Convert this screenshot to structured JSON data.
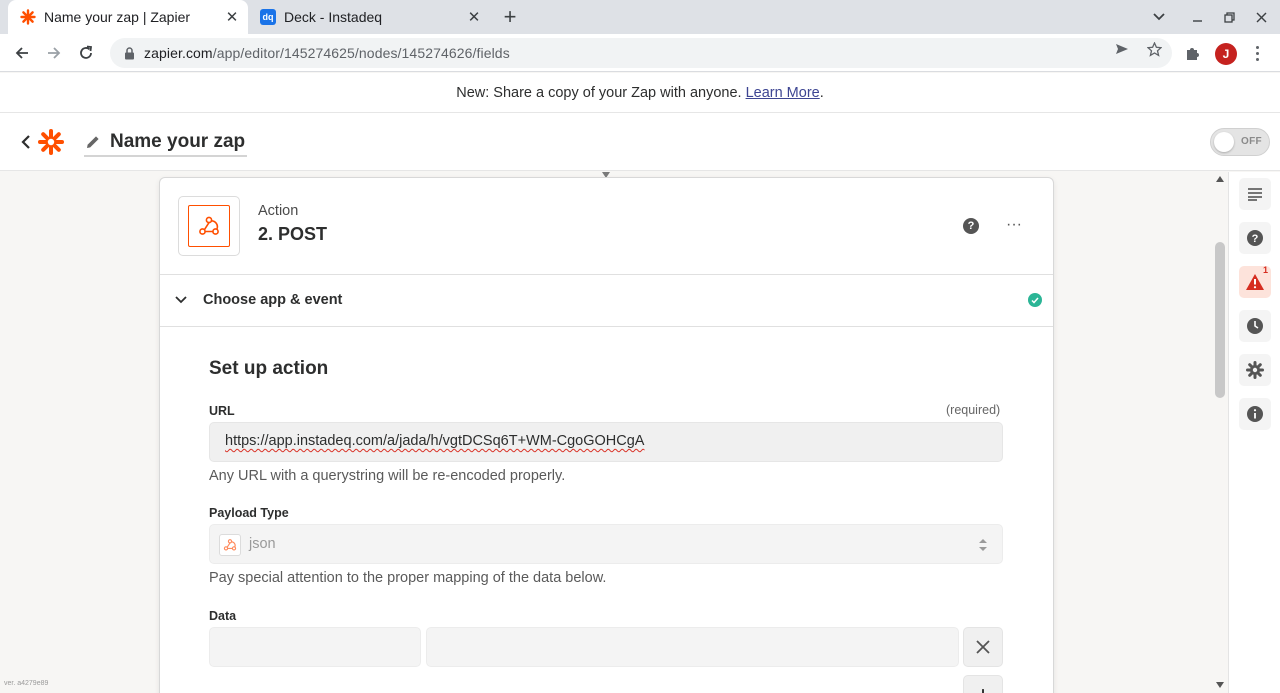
{
  "browser": {
    "tabs": [
      {
        "title": "Name your zap | Zapier",
        "active": true
      },
      {
        "title": "Deck - Instadeq",
        "active": false,
        "favicon_text": "dq"
      }
    ],
    "url": {
      "host": "zapier.com",
      "path": "/app/editor/145274625/nodes/145274626/fields"
    },
    "profile_initial": "J"
  },
  "banner": {
    "text": "New: Share a copy of your Zap with anyone.",
    "link": "Learn More",
    "suffix": "."
  },
  "header": {
    "zap_name": "Name your zap",
    "toggle_label": "OFF"
  },
  "step": {
    "kind": "Action",
    "title": "2. POST",
    "help_glyph": "?",
    "more_glyph": "···",
    "section_title": "Choose app & event"
  },
  "setup": {
    "title": "Set up action",
    "url_field": {
      "label": "URL",
      "required": "(required)",
      "value": "https://app.instadeq.com/a/jada/h/vgtDCSq6T+WM-CgoGOHCgA",
      "help": "Any URL with a querystring will be re-encoded properly."
    },
    "payload_field": {
      "label": "Payload Type",
      "value": "json",
      "help": "Pay special attention to the proper mapping of the data below."
    },
    "data_field": {
      "label": "Data",
      "add_glyph": "+"
    }
  },
  "version": "ver. a4279e89",
  "colors": {
    "zapier_orange": "#ff4f00",
    "success_green": "#2bb596",
    "alert_red": "#d62d20",
    "link": "#3d4592"
  },
  "sidebar": {
    "items": [
      {
        "icon": "details-icon"
      },
      {
        "icon": "help-icon"
      },
      {
        "icon": "warning-icon",
        "badge": "1"
      },
      {
        "icon": "history-icon"
      },
      {
        "icon": "settings-icon"
      },
      {
        "icon": "info-icon"
      }
    ]
  }
}
